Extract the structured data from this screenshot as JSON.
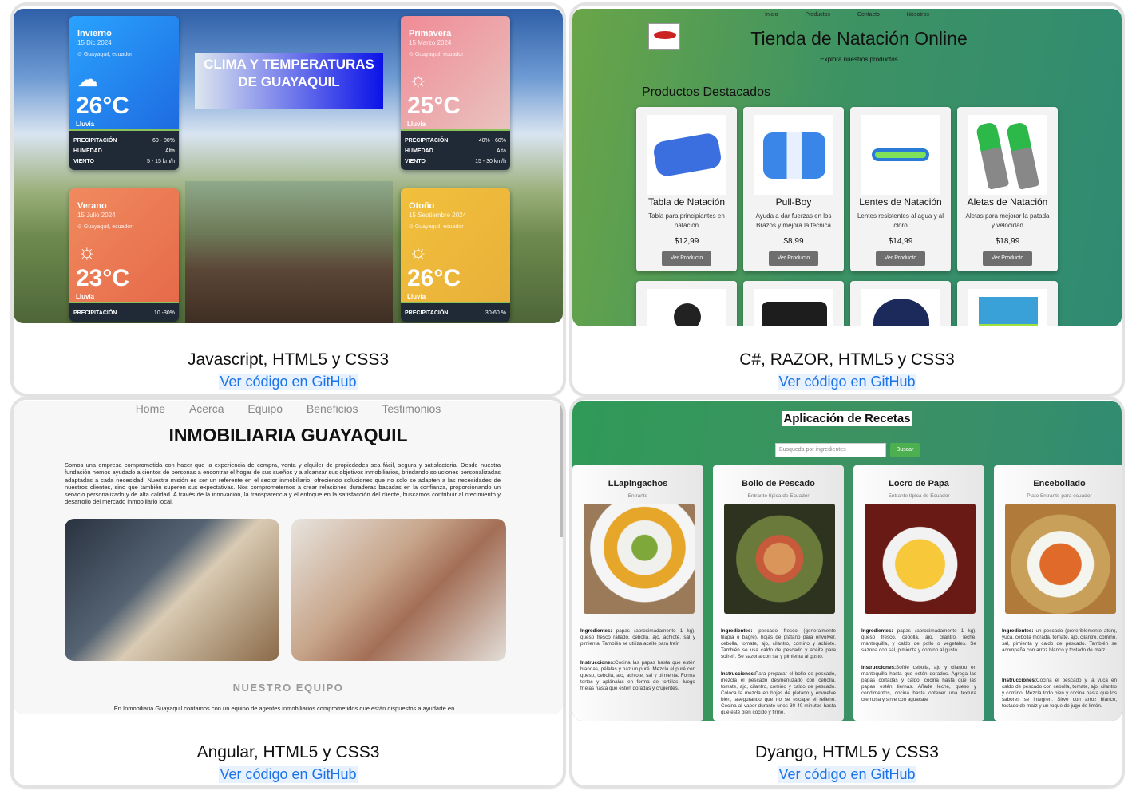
{
  "projects": [
    {
      "tech": "Javascript, HTML5 y CSS3",
      "link": "Ver código en GitHub",
      "preview": {
        "title": "CLIMA Y TEMPERATURAS DE GUAYAQUIL",
        "seasons": [
          {
            "name": "Invierno",
            "date": "15 Dic 2024",
            "location": "Guayaquil, ecuador",
            "temp": "26°C",
            "condition": "Lluvia",
            "icon": "rain-cloud-icon",
            "color": "#1e88f0",
            "stats": [
              [
                "PRECIPITACIÓN",
                "60 - 80%"
              ],
              [
                "HUMEDAD",
                "Alta"
              ],
              [
                "VIENTO",
                "5 - 15 km/h"
              ]
            ]
          },
          {
            "name": "Primavera",
            "date": "15 Marzo 2024",
            "location": "Guayaquil, ecuador",
            "temp": "25°C",
            "condition": "Lluvia",
            "icon": "sun-icon",
            "color": "#ef9aa0",
            "stats": [
              [
                "PRECIPITACIÓN",
                "40% - 60%"
              ],
              [
                "HUMEDAD",
                "Alta"
              ],
              [
                "VIENTO",
                "15 - 30 km/h"
              ]
            ]
          },
          {
            "name": "Verano",
            "date": "15 Julio 2024",
            "location": "Guayaquil, ecuador",
            "temp": "23°C",
            "condition": "Lluvia",
            "icon": "sun-icon",
            "color": "#ef8a56",
            "stats": [
              [
                "PRECIPITACIÓN",
                "10 -30%"
              ]
            ]
          },
          {
            "name": "Otoño",
            "date": "15 Septiembre 2024",
            "location": "Guayaquil, ecuador",
            "temp": "26°C",
            "condition": "Lluvia",
            "icon": "sun-icon",
            "color": "#f0bd3a",
            "stats": [
              [
                "PRECIPITACIÓN",
                "30-60 %"
              ]
            ]
          }
        ]
      }
    },
    {
      "tech": "C#, RAZOR, HTML5 y CSS3",
      "link": "Ver código en GitHub",
      "preview": {
        "nav": [
          "Inicio",
          "Productos",
          "Contacto",
          "Nosotros"
        ],
        "title": "Tienda de Natación Online",
        "subtitle": "Explora nuestros productos",
        "featured": "Productos Destacados",
        "button": "Ver Producto",
        "products": [
          {
            "name": "Tabla de Natación",
            "desc": "Tabla para principiantes en natación",
            "price": "$12,99"
          },
          {
            "name": "Pull-Boy",
            "desc": "Ayuda a dar fuerzas en los Brazos y mejora la técnica",
            "price": "$8,99"
          },
          {
            "name": "Lentes de Natación",
            "desc": "Lentes resistentes al agua y al cloro",
            "price": "$14,99"
          },
          {
            "name": "Aletas de Natación",
            "desc": "Aletas para mejorar la patada y velocidad",
            "price": "$18,99"
          }
        ]
      }
    },
    {
      "tech": "Angular, HTML5 y CSS3",
      "link": "Ver código en GitHub",
      "preview": {
        "nav": [
          "Home",
          "Acerca",
          "Equipo",
          "Beneficios",
          "Testimonios"
        ],
        "title": "INMOBILIARIA GUAYAQUIL",
        "about": "Somos una empresa comprometida con hacer que la experiencia de compra, venta y alquiler de propiedades sea fácil, segura y satisfactoria. Desde nuestra fundación hemos ayudado a cientos de personas a encontrar el hogar de sus sueños y a alcanzar sus objetivos inmobiliarios, brindando soluciones personalizadas adaptadas a cada necesidad. Nuestra misión es ser un referente en el sector inmobiliario, ofreciendo soluciones que no solo se adapten a las necesidades de nuestros clientes, sino que también superen sus expectativas. Nos comprometemos a crear relaciones duraderas basadas en la confianza, proporcionando un servicio personalizado y de alta calidad. A través de la innovación, la transparencia y el enfoque en la satisfacción del cliente, buscamos contribuir al crecimiento y desarrollo del mercado inmobiliario local.",
        "team_heading": "NUESTRO EQUIPO",
        "team_text": "En Inmobiliaria Guayaquil contamos con un equipo de agentes inmobiliarios comprometidos que están dispuestos a ayudarte en"
      }
    },
    {
      "tech": "Dyango, HTML5 y CSS3",
      "link": "Ver código en GitHub",
      "preview": {
        "title": "Aplicación de Recetas",
        "search_placeholder": "Busqueda por ingredientes",
        "search_button": "Buscar",
        "recipes": [
          {
            "name": "LLapingachos",
            "type": "Entrante",
            "ingredients": "papas (aproximadamente 1 kg), queso fresco rallado, cebolla, ajo, achiote, sal y pimienta. También se utiliza aceite para freír",
            "instructions": "Cocina las papas hasta que estén blandas, pélalas y haz un puré. Mezcla el puré con queso, cebolla, ajo, achiote, sal y pimienta. Forma tortas y aplánalas en forma de tortillas, luego fríelas hasta que estén doradas y crujientes.",
            "colors": [
              "#e8c14a",
              "#f2f2f2"
            ]
          },
          {
            "name": "Bollo de Pescado",
            "type": "Entrante típica de Ecuador",
            "ingredients": "pescado fresco (generalmente tilapia o bagre), hojas de plátano para envolver, cebolla, tomate, ajo, cilantro, comino y achiote. También se usa caldo de pescado y aceite para sofreír. Se sazona con sal y pimienta al gusto.",
            "instructions": "Para preparar el bollo de pescado, mezcla el pescado desmenuzado con cebolla, tomate, ajo, cilantro, comino y caldo de pescado. Coloca la mezcla en hojas de plátano y envuelve bien, asegurando que no se escape el relleno. Cocina al vapor durante unos 30-40 minutos hasta que esté bien cocido y firme.",
            "colors": [
              "#c98a4a",
              "#3d4a2a"
            ]
          },
          {
            "name": "Locro de Papa",
            "type": "Entrante típica de Ecuador",
            "ingredients": "papas (aproximadamente 1 kg), queso fresco, cebolla, ajo, cilantro, leche, mantequilla, y caldo de pollo o vegetales. Se sazona con sal, pimienta y comino al gusto.",
            "instructions": "Sofríe cebolla, ajo y cilantro en mantequilla hasta que estén dorados. Agrega las papas cortadas y caldo; cocina hasta que las papas estén tiernas. Añade leche, queso y condimentos, cocina hasta obtener una textura cremosa y sirve con aguacate",
            "colors": [
              "#f2c23a",
              "#7a1e18"
            ]
          },
          {
            "name": "Encebollado",
            "type": "Plato Entrante para ecuador",
            "ingredients": "un pescado (preferiblemente atún), yuca, cebolla morada, tomate, ajo, cilantro, comino, sal, pimienta y caldo de pescado. También se acompaña con arroz blanco y tostado de maíz",
            "instructions": "Cocina el pescado y la yuca en caldo de pescado con cebolla, tomate, ajo, cilantro y comino. Mezcla todo bien y cocina hasta que los sabores se integren. Sirve con arroz blanco, tostado de maíz y un toque de jugo de limón.",
            "colors": [
              "#e0752a",
              "#c9a66a"
            ]
          }
        ]
      }
    }
  ]
}
